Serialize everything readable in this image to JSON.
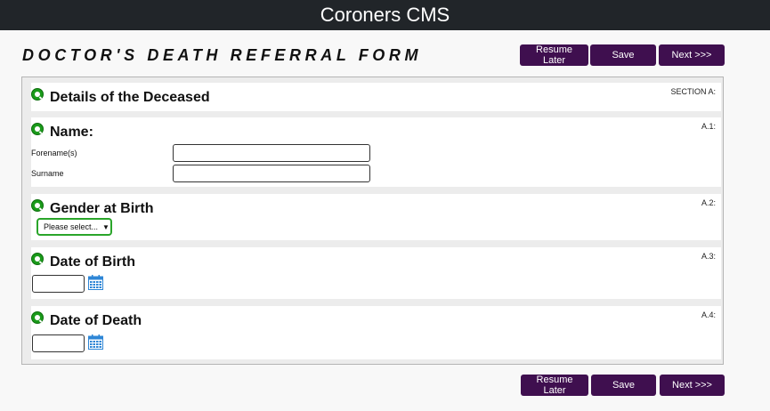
{
  "app_title": "Coroners CMS",
  "form_title": "DOCTOR'S DEATH REFERRAL FORM",
  "buttons": {
    "resume_later": "Resume Later",
    "save": "Save",
    "next": "Next >>>"
  },
  "sections": {
    "deceased": {
      "heading": "Details of the Deceased",
      "ref": "SECTION A:"
    },
    "name": {
      "heading": "Name:",
      "ref": "A.1:",
      "forename_label": "Forename(s)",
      "surname_label": "Surname"
    },
    "gender": {
      "heading": "Gender at Birth",
      "ref": "A.2:",
      "select_value": "Please select..."
    },
    "dob": {
      "heading": "Date of Birth",
      "ref": "A.3:"
    },
    "dod": {
      "heading": "Date of Death",
      "ref": "A.4:"
    }
  },
  "colors": {
    "topbar": "#212529",
    "button": "#3f0f4f",
    "q_icon": "#1a9a1a",
    "calendar": "#2e86d6"
  }
}
